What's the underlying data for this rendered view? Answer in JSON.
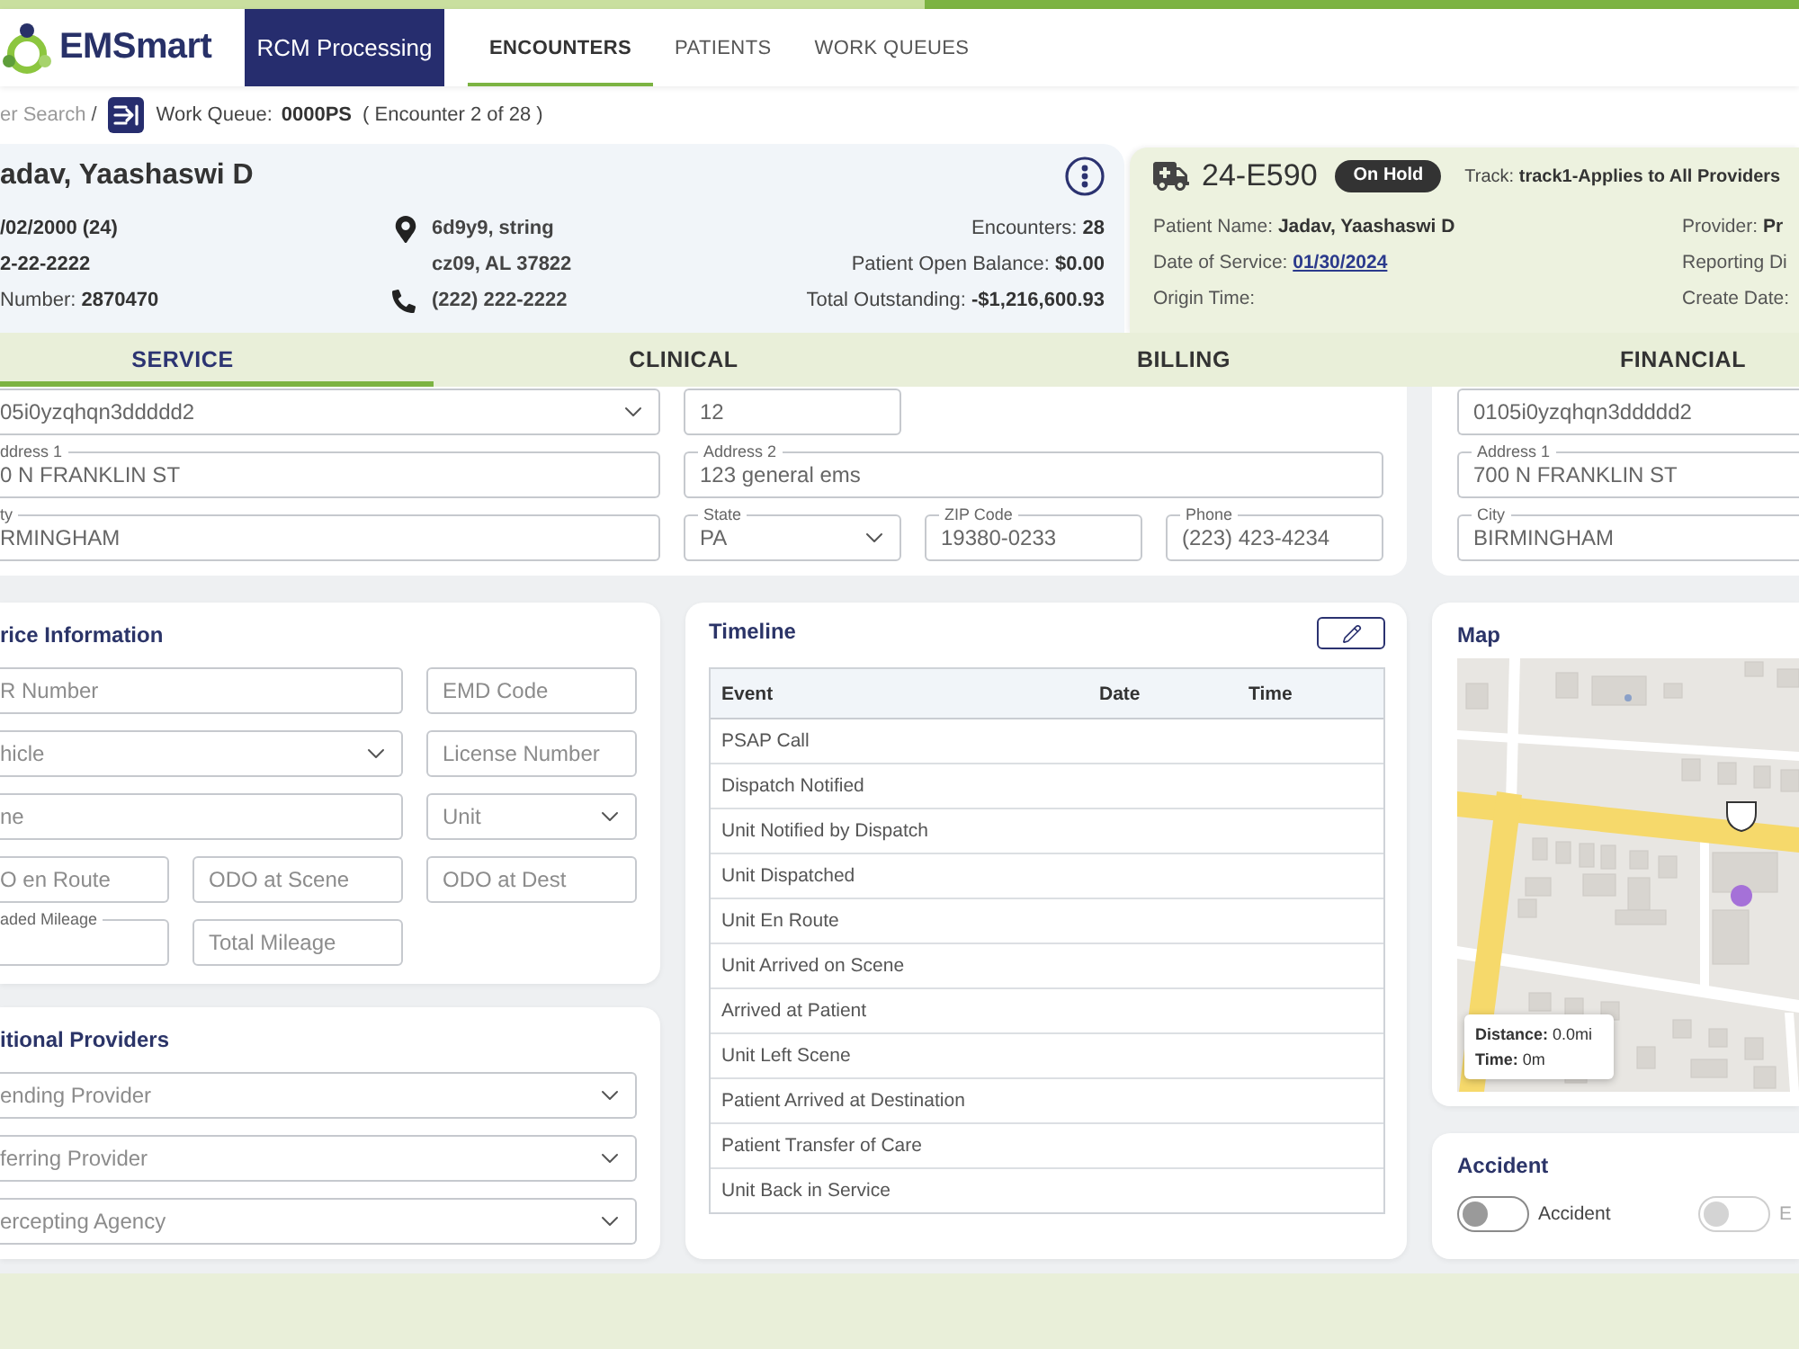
{
  "header": {
    "logo_text": "EMSmart",
    "module": "RCM Processing",
    "nav": [
      {
        "label": "ENCOUNTERS",
        "selected": true
      },
      {
        "label": "PATIENTS",
        "selected": false
      },
      {
        "label": "WORK QUEUES",
        "selected": false
      }
    ]
  },
  "breadcrumb": {
    "link": "er Search",
    "separator": "/",
    "queue_label": "Work Queue:",
    "queue_id": "0000PS",
    "position": "( Encounter 2 of 28 )"
  },
  "patient": {
    "name": "adav, Yaashaswi D",
    "details": [
      {
        "value": "/02/2000 (24)"
      },
      {
        "value": "2-22-2222"
      },
      {
        "label": "Number:",
        "value": "2870470"
      }
    ],
    "address": [
      "6d9y9, string",
      "cz09, AL 37822"
    ],
    "phone": "(222) 222-2222",
    "stats": [
      {
        "label": "Encounters:",
        "value": "28"
      },
      {
        "label": "Patient Open Balance:",
        "value": "$0.00"
      },
      {
        "label": "Total Outstanding:",
        "value": "-$1,216,600.93"
      }
    ]
  },
  "encounter": {
    "number": "24-E590",
    "status": "On Hold",
    "track": {
      "label": "Track:",
      "value": "track1-Applies to All Providers"
    },
    "details": [
      {
        "kind": "text",
        "label": "Patient Name:",
        "value": "Jadav, Yaashaswi D"
      },
      {
        "kind": "link",
        "label": "Date of Service:",
        "value": "01/30/2024"
      },
      {
        "kind": "text",
        "label": "Origin Time:"
      }
    ],
    "details_right": [
      {
        "kind": "text",
        "label": "Provider:",
        "value": "Pr"
      },
      {
        "kind": "text",
        "label": "Reporting Di"
      },
      {
        "kind": "text",
        "label": "Create Date:"
      }
    ]
  },
  "section_tabs": [
    {
      "label": "SERVICE",
      "selected": true
    },
    {
      "label": "CLINICAL",
      "selected": false
    },
    {
      "label": "BILLING",
      "selected": false
    },
    {
      "label": "FINANCIAL",
      "selected": false
    }
  ],
  "address_panel": {
    "fields": [
      {
        "kind": "select",
        "value": "05i0yzqhqn3ddddd2"
      },
      {
        "kind": "input",
        "value": "12"
      },
      {
        "kind": "input",
        "label": "ddress 1",
        "value": "0 N FRANKLIN ST"
      },
      {
        "kind": "input",
        "label": "Address 2",
        "value": "123 general ems"
      },
      {
        "kind": "input",
        "label": "ty",
        "value": "RMINGHAM"
      },
      {
        "kind": "select",
        "label": "State",
        "value": "PA"
      },
      {
        "kind": "input",
        "label": "ZIP Code",
        "value": "19380-0233"
      },
      {
        "kind": "input",
        "label": "Phone",
        "value": "(223) 423-4234"
      }
    ]
  },
  "address_panel_right": {
    "fields": [
      {
        "kind": "input",
        "value": "0105i0yzqhqn3ddddd2"
      },
      {
        "kind": "input",
        "label": "Address 1",
        "value": "700 N FRANKLIN ST"
      },
      {
        "kind": "input",
        "label": "City",
        "value": "BIRMINGHAM"
      }
    ]
  },
  "service_information": {
    "title": "rice Information",
    "fields": [
      {
        "kind": "input",
        "placeholder": "R Number"
      },
      {
        "kind": "input",
        "placeholder": "EMD Code"
      },
      {
        "kind": "select",
        "placeholder": "hicle"
      },
      {
        "kind": "input",
        "placeholder": "License Number"
      },
      {
        "kind": "input",
        "placeholder": "ne"
      },
      {
        "kind": "select",
        "placeholder": "Unit"
      },
      {
        "kind": "input",
        "placeholder": "O en Route"
      },
      {
        "kind": "input",
        "placeholder": "ODO at Scene"
      },
      {
        "kind": "input",
        "placeholder": "ODO at Dest"
      },
      {
        "kind": "input",
        "label": "aded Mileage"
      },
      {
        "kind": "input",
        "placeholder": "Total Mileage"
      }
    ]
  },
  "additional_providers": {
    "title": "itional Providers",
    "fields": [
      {
        "kind": "select",
        "placeholder": "ending Provider"
      },
      {
        "kind": "select",
        "placeholder": "ferring Provider"
      },
      {
        "kind": "select",
        "placeholder": "ercepting Agency"
      }
    ]
  },
  "timeline": {
    "title": "Timeline",
    "columns": [
      "Event",
      "Date",
      "Time"
    ],
    "rows": [
      "PSAP Call",
      "Dispatch Notified",
      "Unit Notified by Dispatch",
      "Unit Dispatched",
      "Unit En Route",
      "Unit Arrived on Scene",
      "Arrived at Patient",
      "Unit Left Scene",
      "Patient Arrived at Destination",
      "Patient Transfer of Care",
      "Unit Back in Service"
    ]
  },
  "map": {
    "title": "Map",
    "route": [
      {
        "label": "Distance:",
        "value": "0.0mi"
      },
      {
        "label": "Time:",
        "value": "0m"
      }
    ]
  },
  "accident": {
    "title": "Accident",
    "toggles": [
      {
        "label": "Accident",
        "on": false,
        "disabled": false
      },
      {
        "label": "E",
        "on": false,
        "disabled": true
      }
    ]
  }
}
